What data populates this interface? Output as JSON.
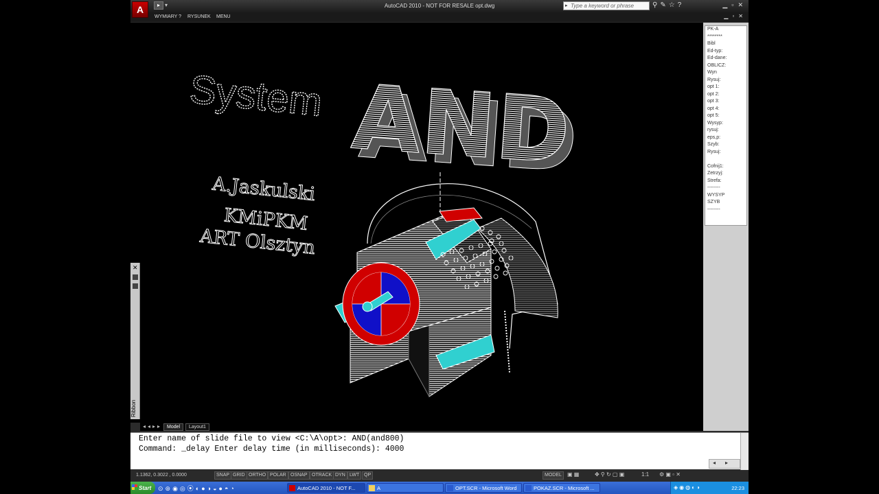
{
  "window": {
    "title": "AutoCAD 2010 - NOT FOR RESALE    opt.dwg",
    "logo_letter": "A",
    "search_placeholder": "Type a keyword or phrase"
  },
  "menubar": {
    "items": [
      "WYMIARY ?",
      "RYSUNEK",
      "MENU"
    ]
  },
  "drawing": {
    "text_system": "System",
    "text_and": "AND",
    "credit_1": "A.Jaskulski",
    "credit_2": "KMiPKM",
    "credit_3": "ART Olsztyn"
  },
  "palette": {
    "ribbon_label": "Ribbon"
  },
  "layout_tabs": {
    "tabs": [
      "Model",
      "Layout1"
    ]
  },
  "side_menu": {
    "items": [
      "PK-A",
      "********",
      "Bibl",
      "Ed-typ:",
      "Ed-dane:",
      "OBLICZ:",
      "Wyn",
      "Rysuj:",
      "opt 1:",
      "opt 2:",
      "opt 3:",
      "opt 4:",
      "opt 5:",
      "Wysyp:",
      "rysuj:",
      "eps,p:",
      "Szyb:",
      "Rysuj:",
      "",
      "Cofnij1:",
      "Zetrzyj:",
      "Strefa:",
      "--------",
      "WYSYP",
      "SZYB",
      "--------"
    ]
  },
  "command": {
    "line1": "Enter name of slide file to view <C:\\A\\opt>: AND(and800)",
    "line2": "Command: _delay Enter delay time (in milliseconds): 4000"
  },
  "statusbar": {
    "coords": "1.1362, 0.3022 , 0.0000",
    "toggles": [
      "SNAP",
      "GRID",
      "ORTHO",
      "POLAR",
      "OSNAP",
      "OTRACK",
      "DYN",
      "LWT",
      "QP"
    ],
    "model_label": "MODEL",
    "scale": "1:1"
  },
  "taskbar": {
    "start_label": "Start",
    "tasks": [
      "AutoCAD 2010 - NOT F...",
      "A",
      "OPT.SCR - Microsoft Word",
      "POKAZ.SCR - Microsoft ..."
    ],
    "clock": "22:23"
  },
  "colors": {
    "drum_red": "#d00000",
    "drum_blue": "#1010c8",
    "plate_cyan": "#30d0d0",
    "hatch_white": "#ffffff"
  }
}
